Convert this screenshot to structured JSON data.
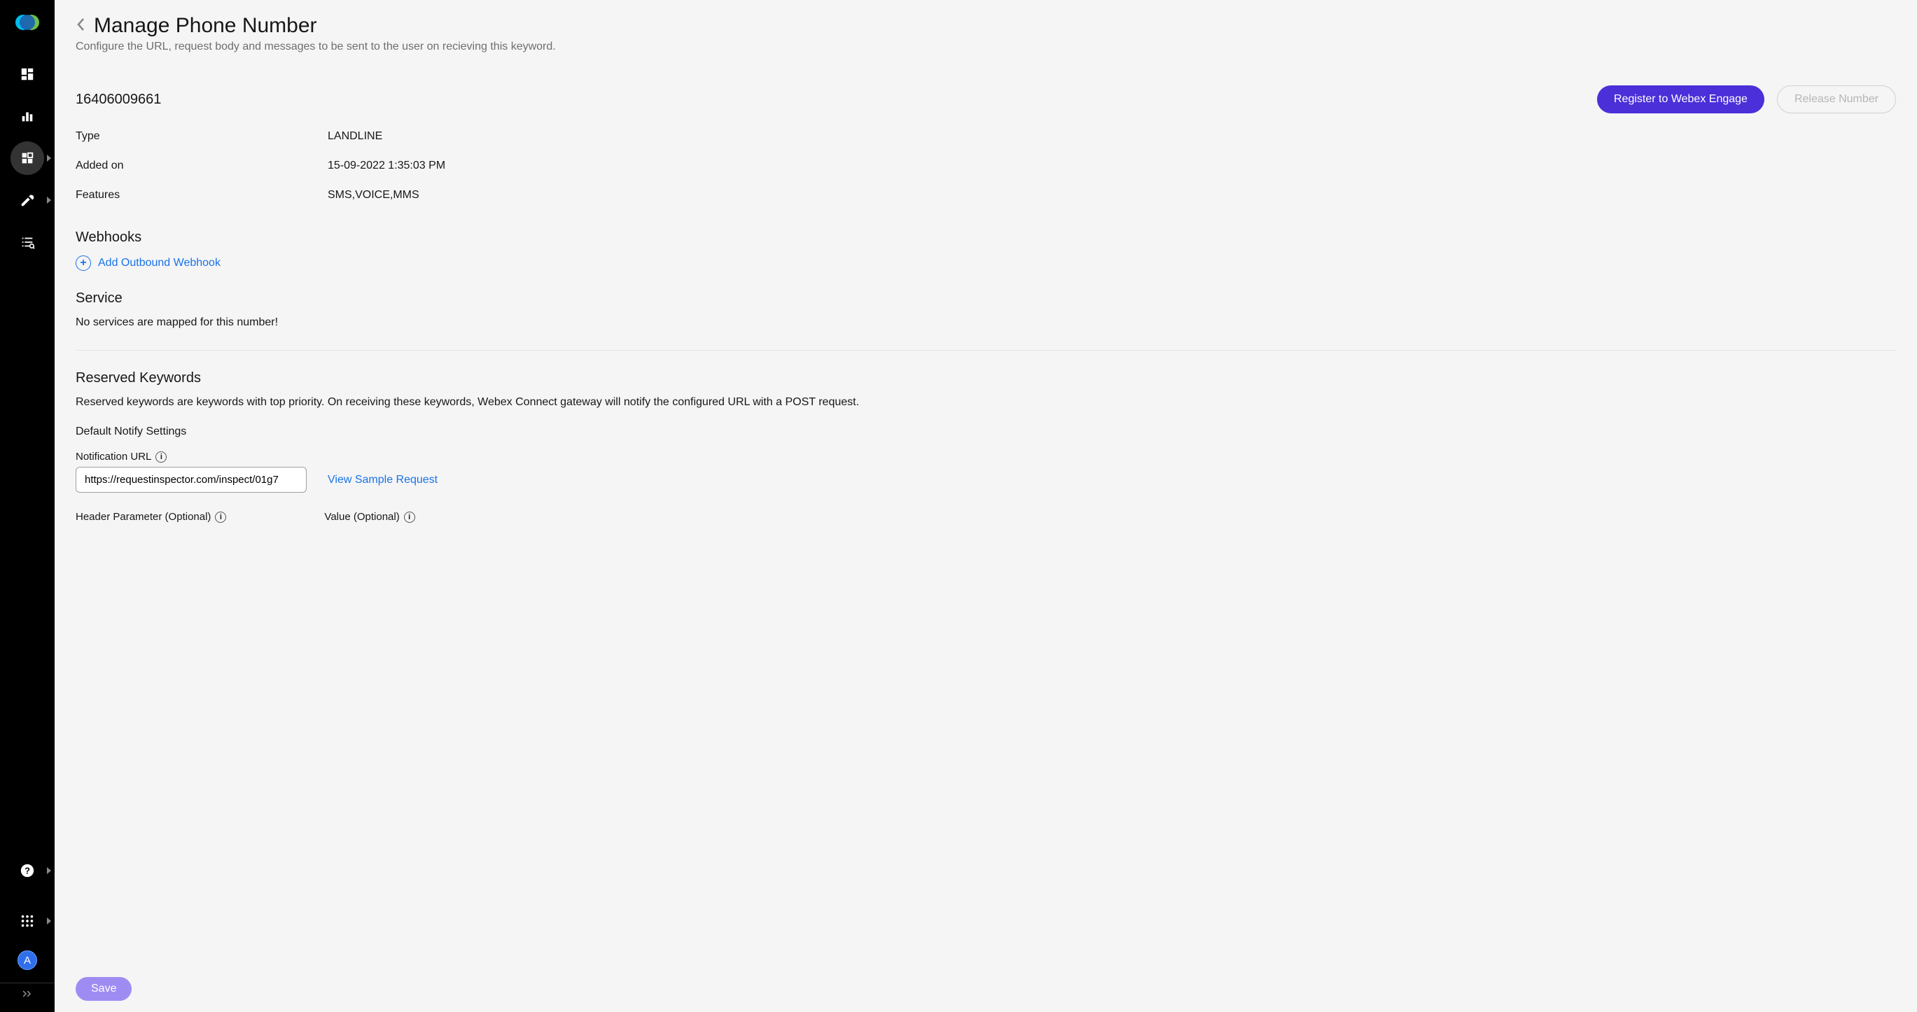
{
  "header": {
    "title": "Manage Phone Number",
    "subtitle": "Configure the URL, request body and messages to be sent to the user on recieving this keyword."
  },
  "number": {
    "value": "16406009661",
    "register_label": "Register to Webex Engage",
    "release_label": "Release Number"
  },
  "details": {
    "type_label": "Type",
    "type_value": "LANDLINE",
    "added_label": "Added on",
    "added_value": "15-09-2022 1:35:03 PM",
    "features_label": "Features",
    "features_value": "SMS,VOICE,MMS"
  },
  "webhooks": {
    "title": "Webhooks",
    "add_label": "Add Outbound Webhook"
  },
  "service": {
    "title": "Service",
    "empty_text": "No services are mapped for this number!"
  },
  "reserved": {
    "title": "Reserved Keywords",
    "desc": "Reserved keywords are keywords with top priority. On receiving these keywords, Webex Connect gateway will notify the configured URL with a POST request.",
    "default_notify": "Default Notify Settings",
    "notification_url_label": "Notification URL",
    "notification_url_value": "https://requestinspector.com/inspect/01g7",
    "view_sample": "View Sample Request",
    "header_param_label": "Header Parameter (Optional)",
    "value_label": "Value (Optional)"
  },
  "footer": {
    "save_label": "Save"
  },
  "sidebar": {
    "avatar_letter": "A"
  }
}
